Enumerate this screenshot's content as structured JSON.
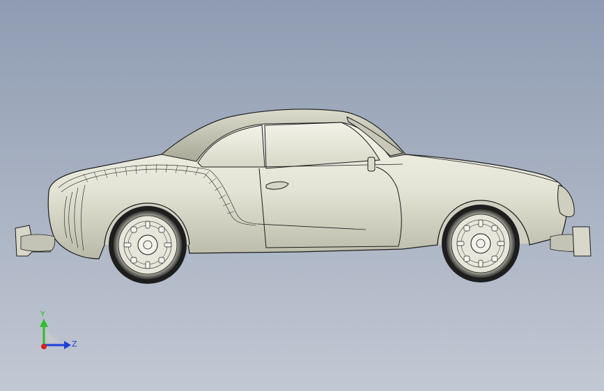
{
  "viewport": {
    "background_top": "#8f9cb2",
    "background_bottom": "#c2c8d3"
  },
  "model": {
    "subject": "car-side-view",
    "body_color": "#e8e8dc",
    "outline_color": "#1a1a1a"
  },
  "triad": {
    "y_label": "Y",
    "z_label": "Z",
    "y_color": "#2fbf2f",
    "z_color": "#1f3fd8",
    "x_color": "#d81f1f"
  }
}
